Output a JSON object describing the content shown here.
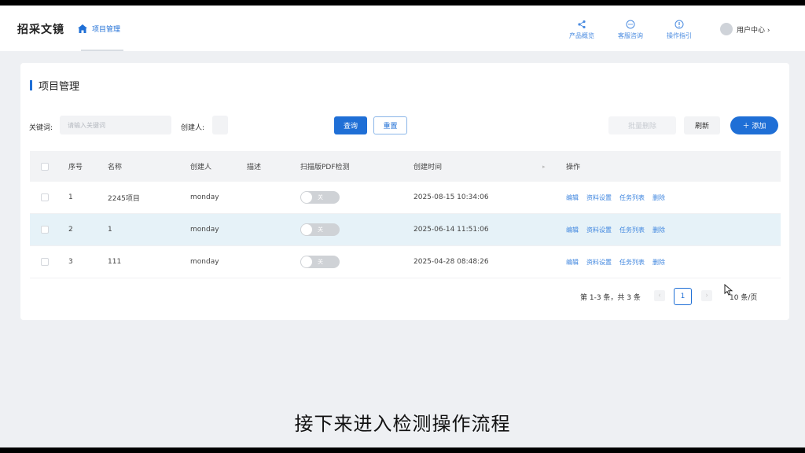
{
  "app": {
    "title": "招采文镜"
  },
  "breadcrumb": {
    "label": "项目管理"
  },
  "topnav": [
    {
      "label": "产品概览",
      "icon": "share-icon"
    },
    {
      "label": "客服咨询",
      "icon": "chat-icon"
    },
    {
      "label": "操作指引",
      "icon": "info-icon"
    }
  ],
  "user": {
    "label": "用户中心 ›"
  },
  "page": {
    "title": "项目管理"
  },
  "filters": {
    "keyword_label": "关键词:",
    "keyword_placeholder": "请输入关键词",
    "creator_label": "创建人:",
    "creator_value": ""
  },
  "buttons": {
    "search": "查询",
    "reset": "重置",
    "batch_delete": "批量删除",
    "refresh": "刷新",
    "add": "＋ 添加"
  },
  "table": {
    "columns": [
      "序号",
      "名称",
      "创建人",
      "描述",
      "扫描版PDF检测",
      "创建时间",
      "操作"
    ],
    "rows": [
      {
        "index": "1",
        "name": "2245项目",
        "creator": "monday",
        "desc": "",
        "toggle": "关",
        "created": "2025-08-15 10:34:06"
      },
      {
        "index": "2",
        "name": "1",
        "creator": "monday",
        "desc": "",
        "toggle": "关",
        "created": "2025-06-14 11:51:06"
      },
      {
        "index": "3",
        "name": "111",
        "creator": "monday",
        "desc": "",
        "toggle": "关",
        "created": "2025-04-28 08:48:26"
      }
    ],
    "ops": [
      "编辑",
      "资料设置",
      "任务列表",
      "删除"
    ]
  },
  "pagination": {
    "total": "第 1-3 条，共 3 条",
    "current": "1",
    "size": "10 条/页"
  },
  "subtitle": "接下来进入检测操作流程",
  "colors": {
    "accent": "#1f6fd6",
    "highlight_row": "#e6f2f8"
  }
}
